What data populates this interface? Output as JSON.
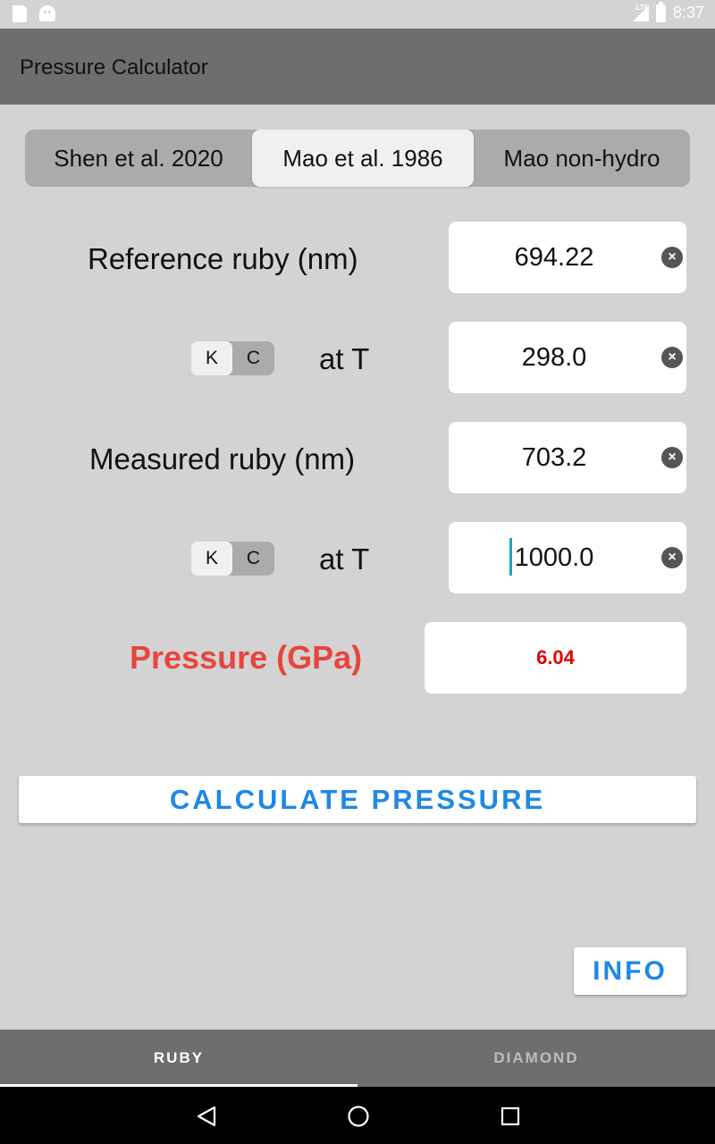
{
  "status_bar": {
    "network": "LTE",
    "time": "8:37"
  },
  "app": {
    "title": "Pressure Calculator"
  },
  "calibration_tabs": [
    {
      "label": "Shen et al. 2020",
      "selected": false
    },
    {
      "label": "Mao et al. 1986",
      "selected": true
    },
    {
      "label": "Mao non-hydro",
      "selected": false
    }
  ],
  "reference_ruby": {
    "label": "Reference ruby (nm)",
    "value": "694.22"
  },
  "reference_temp": {
    "label": "at T",
    "value": "298.0",
    "unit_k": "K",
    "unit_c": "C",
    "selected_unit": "K"
  },
  "measured_ruby": {
    "label": "Measured ruby (nm)",
    "value": "703.2"
  },
  "measured_temp": {
    "label": "at T",
    "value": "1000.0",
    "unit_k": "K",
    "unit_c": "C",
    "selected_unit": "K"
  },
  "pressure": {
    "label": "Pressure (GPa)",
    "value": "6.04"
  },
  "buttons": {
    "calculate": "CALCULATE PRESSURE",
    "info": "INFO"
  },
  "bottom_tabs": [
    {
      "label": "RUBY",
      "active": true
    },
    {
      "label": "DIAMOND",
      "active": false
    }
  ],
  "colors": {
    "accent": "#1e88e5",
    "pressure_label": "#e8453c",
    "pressure_value": "#e00000",
    "app_bar": "#6e6e6e",
    "background": "#d3d3d3"
  }
}
